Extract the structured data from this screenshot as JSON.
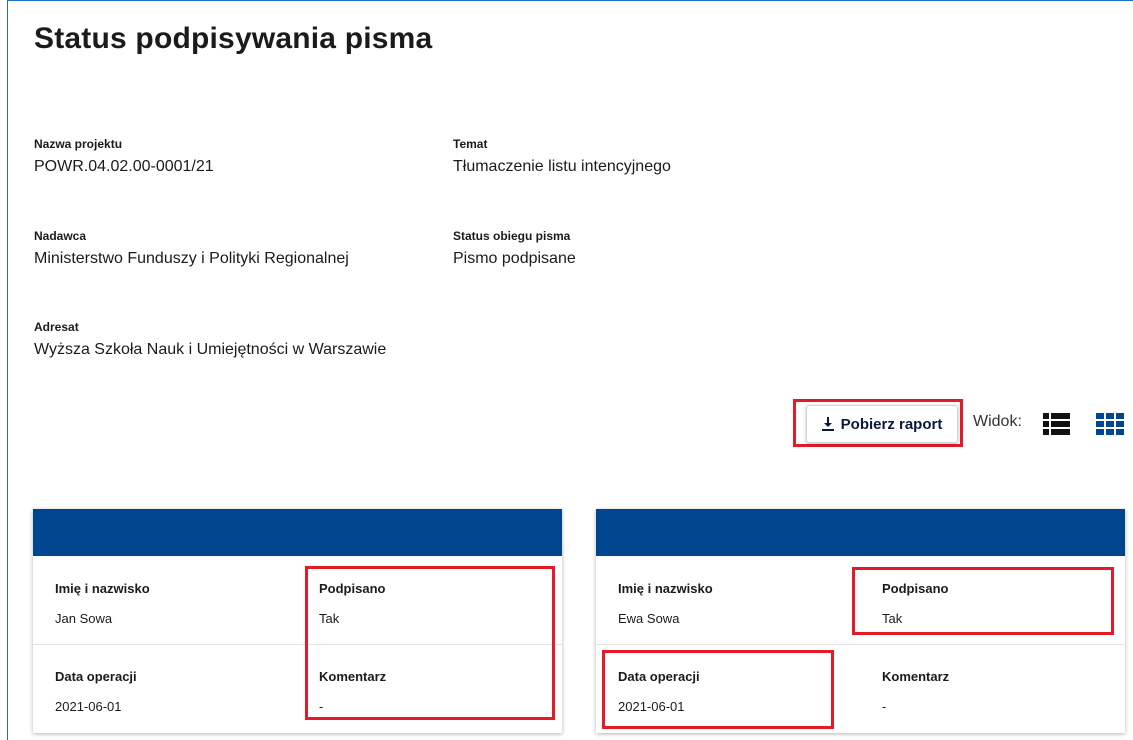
{
  "page": {
    "title": "Status podpisywania pisma"
  },
  "details": {
    "project_label": "Nazwa projektu",
    "project_value": "POWR.04.02.00-0001/21",
    "topic_label": "Temat",
    "topic_value": "Tłumaczenie listu intencyjnego",
    "sender_label": "Nadawca",
    "sender_value": "Ministerstwo Funduszy i Polityki Regionalnej",
    "status_label": "Status obiegu pisma",
    "status_value": "Pismo podpisane",
    "addressee_label": "Adresat",
    "addressee_value": "Wyższa Szkoła Nauk i Umiejętności w Warszawie"
  },
  "toolbar": {
    "download_label": "Pobierz raport",
    "download_icon": "download-icon",
    "view_label": "Widok:",
    "list_view_icon": "list-view-icon",
    "grid_view_icon": "grid-view-icon"
  },
  "labels": {
    "name": "Imię i nazwisko",
    "signed": "Podpisano",
    "date": "Data operacji",
    "comment": "Komentarz"
  },
  "cards": [
    {
      "name": "Jan Sowa",
      "signed": "Tak",
      "date": "2021-06-01",
      "comment": "-"
    },
    {
      "name": "Ewa Sowa",
      "signed": "Tak",
      "date": "2021-06-01",
      "comment": "-"
    }
  ],
  "colors": {
    "card_header": "#00468f",
    "highlight": "#e21b27",
    "frame": "#1f6fc2"
  }
}
